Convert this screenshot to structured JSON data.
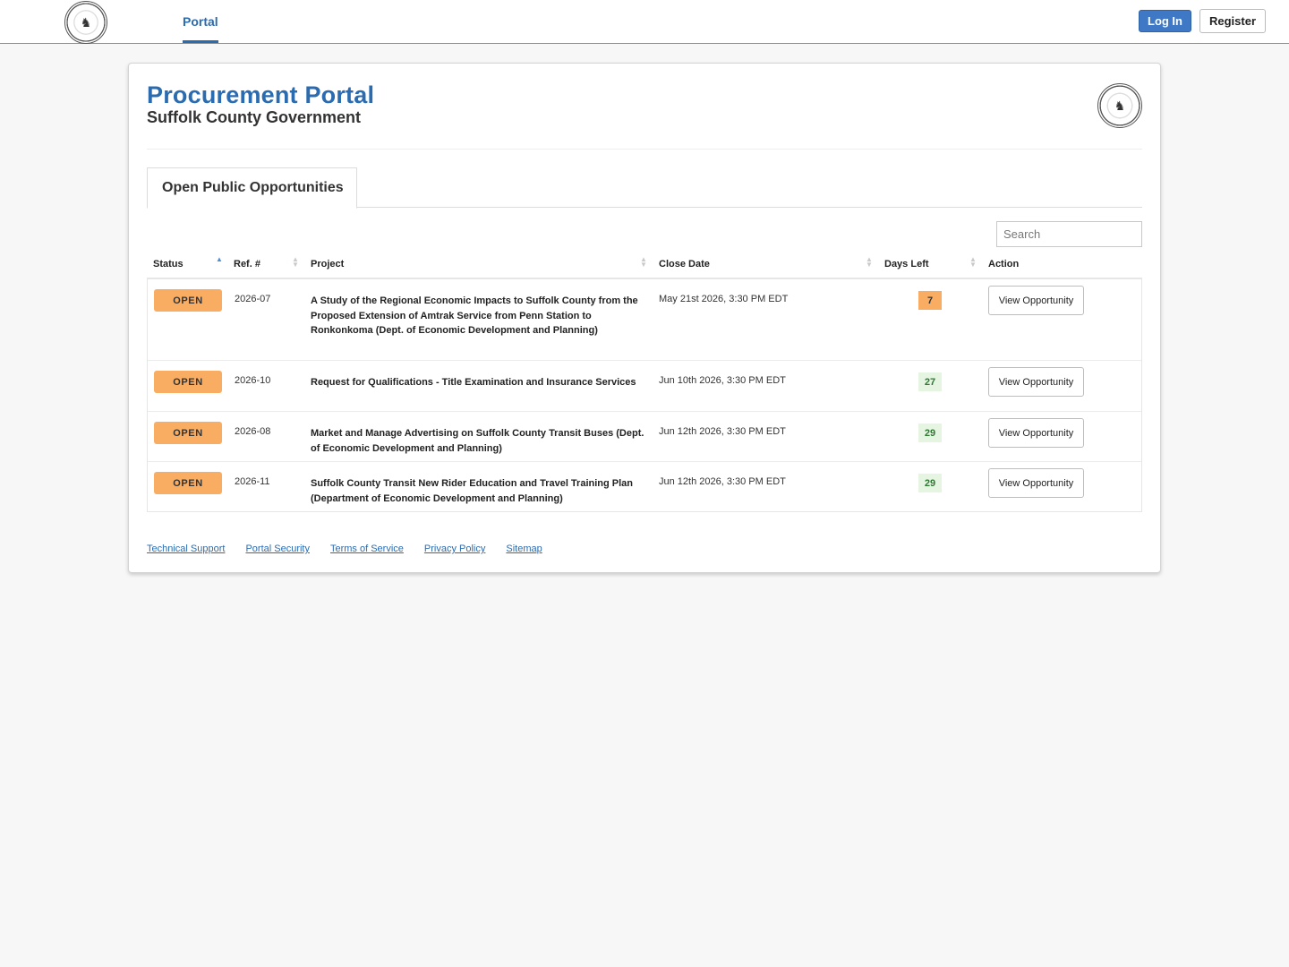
{
  "nav": {
    "portal_link": "Portal",
    "login_label": "Log In",
    "register_label": "Register"
  },
  "header": {
    "title": "Procurement Portal",
    "subtitle": "Suffolk County Government"
  },
  "tabs": [
    {
      "label": "Open Public Opportunities"
    }
  ],
  "search": {
    "placeholder": "Search"
  },
  "table": {
    "columns": [
      "Status",
      "Ref. #",
      "Project",
      "Close Date",
      "Days Left",
      "Action"
    ],
    "rows": [
      {
        "status": "OPEN",
        "ref": "2026-07",
        "project": "A Study of the Regional Economic Impacts to Suffolk County from the Proposed Extension of Amtrak Service from Penn Station to Ronkonkoma (Dept. of Economic Development and Planning)",
        "close_date": "May 21st 2026, 3:30 PM EDT",
        "days_left": "7",
        "action": "View Opportunity"
      },
      {
        "status": "OPEN",
        "ref": "2026-10",
        "project": "Request for Qualifications - Title Examination and Insurance Services",
        "close_date": "Jun 10th 2026, 3:30 PM EDT",
        "days_left": "27",
        "action": "View Opportunity"
      },
      {
        "status": "OPEN",
        "ref": "2026-08",
        "project": "Market and Manage Advertising on Suffolk County Transit Buses (Dept. of Economic Development and Planning)",
        "close_date": "Jun 12th 2026, 3:30 PM EDT",
        "days_left": "29",
        "action": "View Opportunity"
      },
      {
        "status": "OPEN",
        "ref": "2026-11",
        "project": "Suffolk County Transit New Rider Education and Travel Training Plan (Department of Economic Development and Planning)",
        "close_date": "Jun 12th 2026, 3:30 PM EDT",
        "days_left": "29",
        "action": "View Opportunity"
      }
    ]
  },
  "footer": {
    "links": [
      "Technical Support",
      "Portal Security",
      "Terms of Service",
      "Privacy Policy",
      "Sitemap"
    ]
  },
  "colors": {
    "brand_blue": "#2b6cb0",
    "login_blue": "#3f78c4",
    "open_orange": "#f8ad63",
    "days_ok_bg": "#e6f4e2",
    "days_ok_text": "#2d7a31"
  },
  "icons": {
    "nav_logo": "county-seal-icon",
    "card_logo": "county-seal-icon",
    "sort_active": "sort-ascending-icon",
    "sort_inactive": "sort-both-icon"
  }
}
